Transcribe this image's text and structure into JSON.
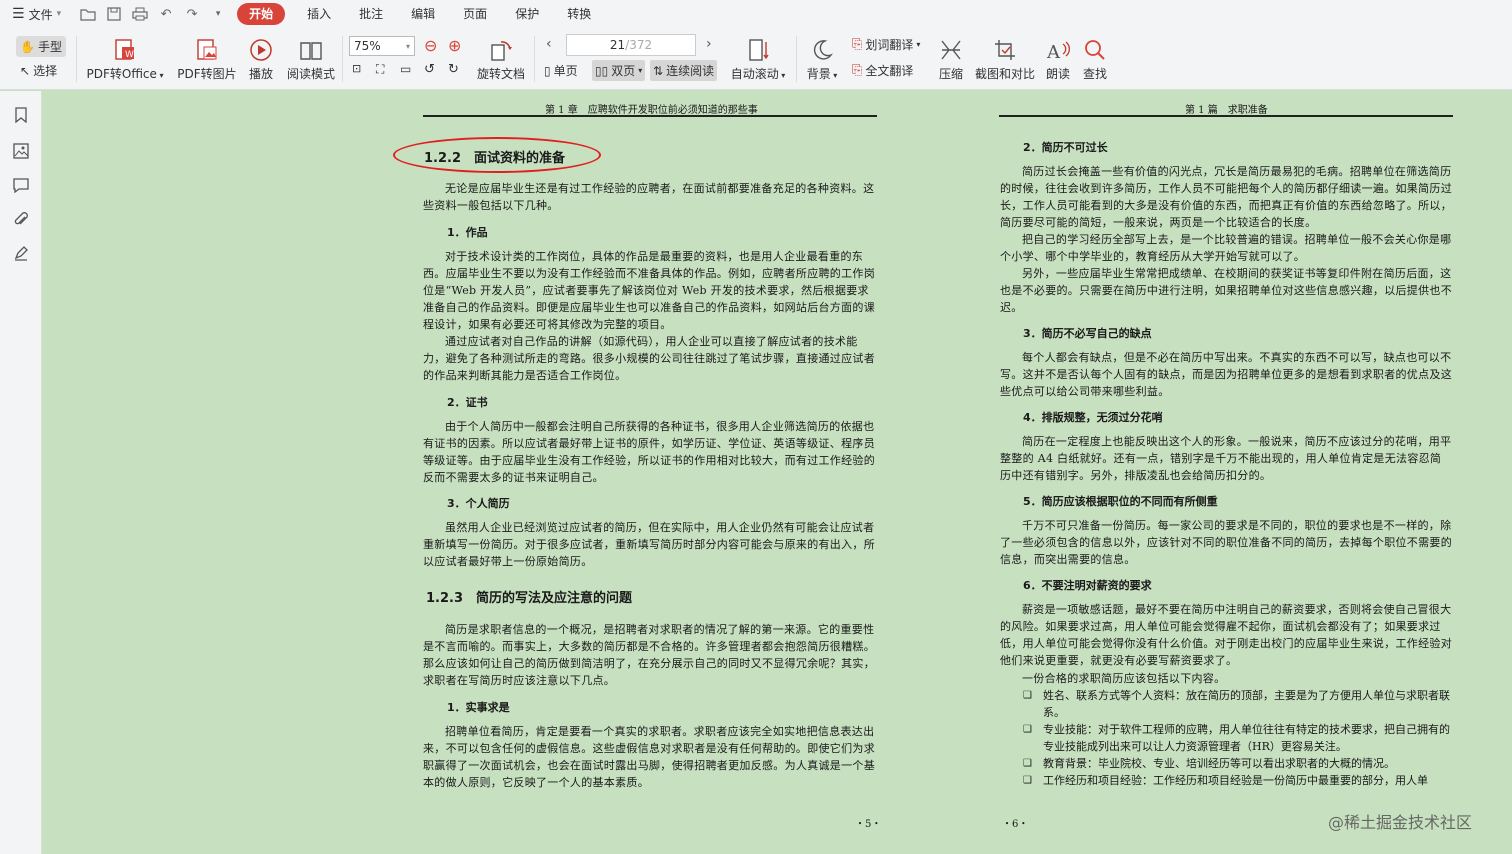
{
  "menubar": {
    "file_label": "文件",
    "tabs": [
      {
        "label": "开始",
        "active": true
      },
      {
        "label": "插入"
      },
      {
        "label": "批注"
      },
      {
        "label": "编辑"
      },
      {
        "label": "页面"
      },
      {
        "label": "保护"
      },
      {
        "label": "转换"
      }
    ]
  },
  "toolbar": {
    "hand": "手型",
    "select": "选择",
    "pdf_to_office": "PDF转Office",
    "pdf_to_image": "PDF转图片",
    "play": "播放",
    "read_mode": "阅读模式",
    "zoom": "75%",
    "rotate": "旋转文档",
    "page_current": "21",
    "page_total": "/372",
    "single": "单页",
    "double": "双页",
    "continuous": "连续阅读",
    "auto_scroll": "自动滚动",
    "background": "背景",
    "word_translate": "划词翻译",
    "full_translate": "全文翻译",
    "compress": "压缩",
    "screenshot_compare": "截图和对比",
    "read_aloud": "朗读",
    "find": "查找"
  },
  "left_page": {
    "header": "第 1 章　应聘软件开发职位前必须知道的那些事",
    "sec_122": "1.2.2　面试资料的准备",
    "p_intro": "无论是应届毕业生还是有过工作经验的应聘者，在面试前都要准备充足的各种资料。这些资料一般包括以下几种。",
    "s1": "1．作品",
    "p_s1a": "对于技术设计类的工作岗位，具体的作品是最重要的资料，也是用人企业最看重的东西。应届毕业生不要以为没有工作经验而不准备具体的作品。例如，应聘者所应聘的工作岗位是“Web 开发人员”，应试者要事先了解该岗位对 Web 开发的技术要求，然后根据要求准备自己的作品资料。即便是应届毕业生也可以准备自己的作品资料，如网站后台方面的课程设计，如果有必要还可将其修改为完整的项目。",
    "p_s1b": "通过应试者对自己作品的讲解（如源代码），用人企业可以直接了解应试者的技术能力，避免了各种测试所走的弯路。很多小规模的公司往往跳过了笔试步骤，直接通过应试者的作品来判断其能力是否适合工作岗位。",
    "s2": "2．证书",
    "p_s2": "由于个人简历中一般都会注明自己所获得的各种证书，很多用人企业筛选简历的依据也有证书的因素。所以应试者最好带上证书的原件，如学历证、学位证、英语等级证、程序员等级证等。由于应届毕业生没有工作经验，所以证书的作用相对比较大，而有过工作经验的反而不需要太多的证书来证明自己。",
    "s3": "3．个人简历",
    "p_s3": "虽然用人企业已经浏览过应试者的简历，但在实际中，用人企业仍然有可能会让应试者重新填写一份简历。对于很多应试者，重新填写简历时部分内容可能会与原来的有出入，所以应试者最好带上一份原始简历。",
    "sec_123": "1.2.3　简历的写法及应注意的问题",
    "p_123": "简历是求职者信息的一个概况，是招聘者对求职者的情况了解的第一来源。它的重要性是不言而喻的。而事实上，大多数的简历都是不合格的。许多管理者都会抱怨简历很糟糕。那么应该如何让自己的简历做到简洁明了，在充分展示自己的同时又不显得冗余呢？其实，求职者在写简历时应该注意以下几点。",
    "s4": "1．实事求是",
    "p_s4": "招聘单位看简历，肯定是要看一个真实的求职者。求职者应该完全如实地把信息表达出来，不可以包含任何的虚假信息。这些虚假信息对求职者是没有任何帮助的。即使它们为求职赢得了一次面试机会，也会在面试时露出马脚，使得招聘者更加反感。为人真诚是一个基本的做人原则，它反映了一个人的基本素质。",
    "page_no": "・5・"
  },
  "right_page": {
    "header": "第 1 篇　求职准备",
    "s2": "2．简历不可过长",
    "p2a": "简历过长会掩盖一些有价值的闪光点，冗长是简历最易犯的毛病。招聘单位在筛选简历的时候，往往会收到许多简历，工作人员不可能把每个人的简历都仔细读一遍。如果简历过长，工作人员可能看到的大多是没有价值的东西，而把真正有价值的东西给忽略了。所以，简历要尽可能的简短，一般来说，两页是一个比较适合的长度。",
    "p2b": "把自己的学习经历全部写上去，是一个比较普遍的错误。招聘单位一般不会关心你是哪个小学、哪个中学毕业的，教育经历从大学开始写就可以了。",
    "p2c": "另外，一些应届毕业生常常把成绩单、在校期间的获奖证书等复印件附在简历后面，这也是不必要的。只需要在简历中进行注明，如果招聘单位对这些信息感兴趣，以后提供也不迟。",
    "s3": "3．简历不必写自己的缺点",
    "p3": "每个人都会有缺点，但是不必在简历中写出来。不真实的东西不可以写，缺点也可以不写。这并不是否认每个人固有的缺点，而是因为招聘单位更多的是想看到求职者的优点及这些优点可以给公司带来哪些利益。",
    "s4": "4．排版规整，无须过分花哨",
    "p4": "简历在一定程度上也能反映出这个人的形象。一般说来，简历不应该过分的花哨，用平整整的 A4 白纸就好。还有一点，错别字是千万不能出现的，用人单位肯定是无法容忍简历中还有错别字。另外，排版凌乱也会给简历扣分的。",
    "s5": "5．简历应该根据职位的不同而有所侧重",
    "p5": "千万不可只准备一份简历。每一家公司的要求是不同的，职位的要求也是不一样的，除了一些必须包含的信息以外，应该针对不同的职位准备不同的简历，去掉每个职位不需要的信息，而突出需要的信息。",
    "s6": "6．不要注明对薪资的要求",
    "p6a": "薪资是一项敏感话题，最好不要在简历中注明自己的薪资要求，否则将会使自己冒很大的风险。如果要求过高，用人单位可能会觉得雇不起你，面试机会都没有了；如果要求过低，用人单位可能会觉得你没有什么价值。对于刚走出校门的应届毕业生来说，工作经验对他们来说更重要，就更没有必要写薪资要求了。",
    "p6b": "一份合格的求职简历应该包括以下内容。",
    "bullets": [
      "姓名、联系方式等个人资料：放在简历的顶部，主要是为了方便用人单位与求职者联系。",
      "专业技能：对于软件工程师的应聘，用人单位往往有特定的技术要求，把自己拥有的专业技能成列出来可以让人力资源管理者（HR）更容易关注。",
      "教育背景：毕业院校、专业、培训经历等可以看出求职者的大概的情况。",
      "工作经历和项目经验：工作经历和项目经验是一份简历中最重要的部分，用人单"
    ],
    "page_no": "・6・"
  },
  "watermark": "@稀土掘金技术社区"
}
